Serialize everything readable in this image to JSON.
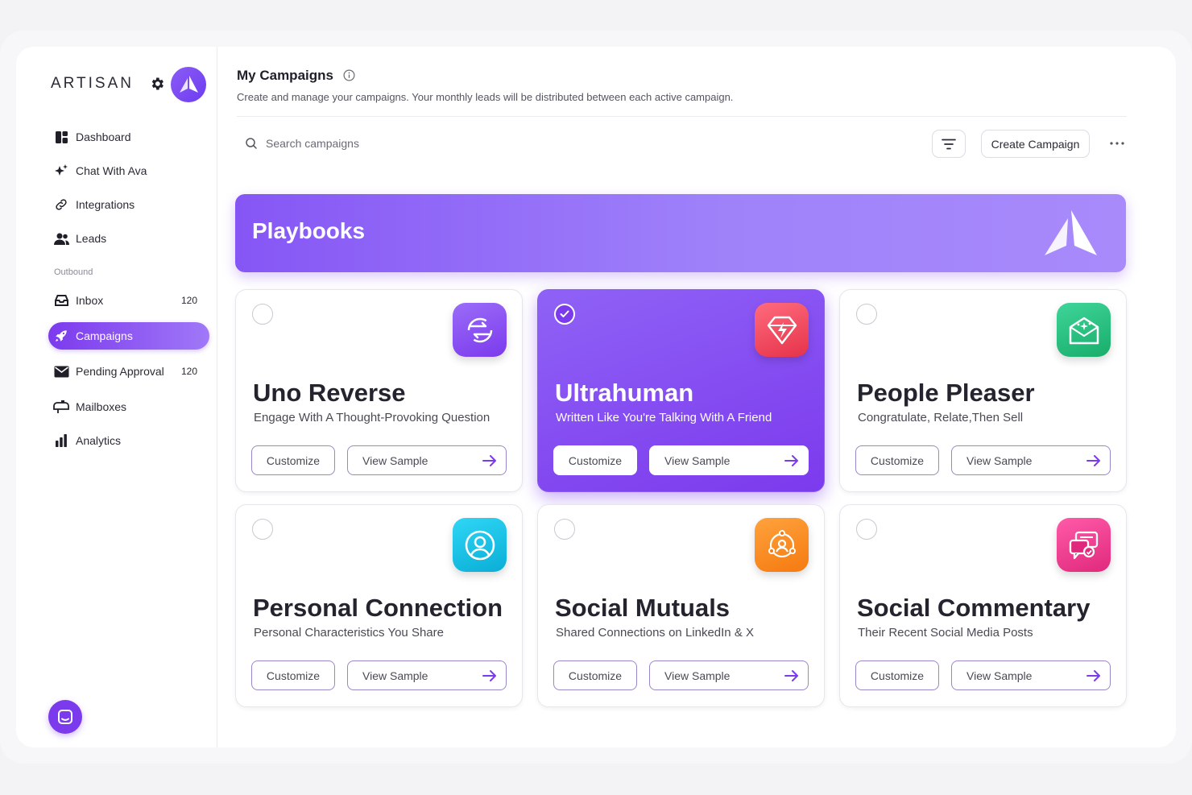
{
  "sidebar": {
    "brand": "ARTISAN",
    "items": [
      {
        "label": "Dashboard",
        "icon": "dashboard-icon"
      },
      {
        "label": "Chat With Ava",
        "icon": "sparkle-icon"
      },
      {
        "label": "Integrations",
        "icon": "link-icon"
      },
      {
        "label": "Leads",
        "icon": "users-icon"
      }
    ],
    "section_label": "Outbound",
    "outbound_items": [
      {
        "label": "Inbox",
        "count": "120",
        "icon": "inbox-icon"
      },
      {
        "label": "Campaigns",
        "icon": "rocket-icon",
        "active": true
      },
      {
        "label": "Pending Approval",
        "count": "120",
        "icon": "envelope-icon"
      },
      {
        "label": "Mailboxes",
        "icon": "mailbox-icon"
      },
      {
        "label": "Analytics",
        "icon": "bar-chart-icon"
      }
    ]
  },
  "header": {
    "title": "My Campaigns",
    "subtitle": "Create and manage your campaigns. Your monthly leads will be distributed between each active campaign."
  },
  "toolbar": {
    "search_placeholder": "Search campaigns",
    "create_label": "Create Campaign"
  },
  "banner": {
    "title": "Playbooks"
  },
  "cards": [
    {
      "title": "Uno Reverse",
      "subtitle": "Engage With A Thought-Provoking Question",
      "customize": "Customize",
      "view": "View Sample",
      "selected": false,
      "icon": "swap-arrows-icon",
      "color": "#8b5cf6"
    },
    {
      "title": "Ultrahuman",
      "subtitle": "Written Like You're Talking With A Friend",
      "customize": "Customize",
      "view": "View Sample",
      "selected": true,
      "icon": "diamond-bolt-icon",
      "color": "#f0475c"
    },
    {
      "title": "People Pleaser",
      "subtitle": "Congratulate, Relate,Then Sell",
      "customize": "Customize",
      "view": "View Sample",
      "selected": false,
      "icon": "envelope-sparkle-icon",
      "color": "#22c27a"
    },
    {
      "title": "Personal Connection",
      "subtitle": "Personal Characteristics You Share",
      "customize": "Customize",
      "view": "View Sample",
      "selected": false,
      "icon": "user-circle-icon",
      "color": "#12c3e8"
    },
    {
      "title": "Social Mutuals",
      "subtitle": "Shared Connections on LinkedIn & X",
      "customize": "Customize",
      "view": "View Sample",
      "selected": false,
      "icon": "network-icon",
      "color": "#fb8c22"
    },
    {
      "title": "Social Commentary",
      "subtitle": "Their Recent Social Media Posts",
      "customize": "Customize",
      "view": "View Sample",
      "selected": false,
      "icon": "chat-posts-icon",
      "color": "#ee3d8f"
    }
  ],
  "colors": {
    "accent": "#7c3aed",
    "banner": "#9b77f8"
  }
}
